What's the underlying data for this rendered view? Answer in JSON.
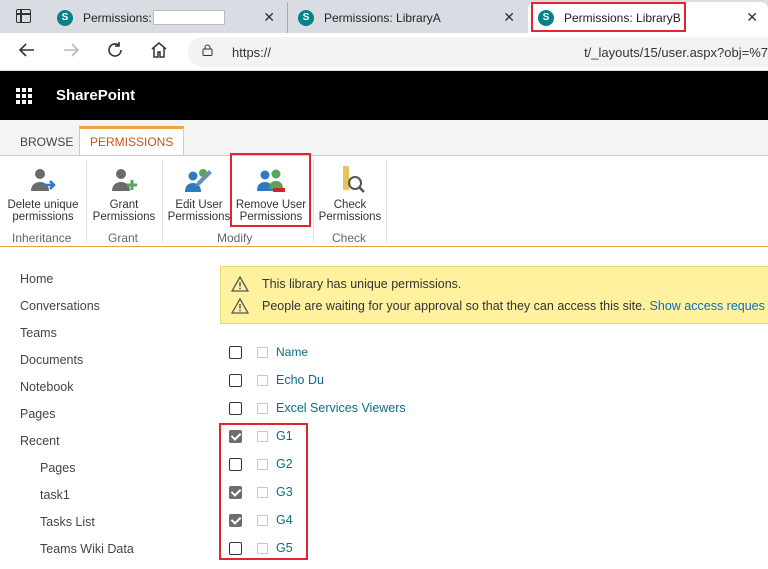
{
  "browser": {
    "tabs": [
      {
        "title": "Permissions:",
        "active": false
      },
      {
        "title": "Permissions: LibraryA",
        "active": false
      },
      {
        "title": "Permissions: LibraryB",
        "active": true
      }
    ],
    "close_glyph": "✕",
    "address": {
      "url_start": "https://",
      "url_end": "t/_layouts/15/user.aspx?obj=%7"
    }
  },
  "suite": {
    "brand": "SharePoint"
  },
  "ribbon": {
    "tabs": [
      "BROWSE",
      "PERMISSIONS"
    ],
    "active_tab": "PERMISSIONS",
    "buttons": [
      {
        "label1": "Delete unique",
        "label2": "permissions",
        "icon": "delete-unique-permissions-icon"
      },
      {
        "label1": "Grant",
        "label2": "Permissions",
        "icon": "grant-permissions-icon"
      },
      {
        "label1": "Edit User",
        "label2": "Permissions",
        "icon": "edit-user-permissions-icon"
      },
      {
        "label1": "Remove User",
        "label2": "Permissions",
        "icon": "remove-user-permissions-icon"
      },
      {
        "label1": "Check",
        "label2": "Permissions",
        "icon": "check-permissions-icon"
      }
    ],
    "groups": [
      "Inheritance",
      "Grant",
      "Modify",
      "Check"
    ]
  },
  "leftnav": {
    "items": [
      "Home",
      "Conversations",
      "Teams",
      "Documents",
      "Notebook",
      "Pages",
      "Recent"
    ],
    "sub_items": [
      "Pages",
      "task1",
      "Tasks List",
      "Teams Wiki Data"
    ]
  },
  "banner": {
    "line1": "This library has unique permissions.",
    "line2": "People are waiting for your approval so that they can access this site.",
    "link": "Show access reques"
  },
  "list": {
    "header": "Name",
    "rows": [
      {
        "name": "Echo Du",
        "checked": false
      },
      {
        "name": "Excel Services Viewers",
        "checked": false
      },
      {
        "name": "G1",
        "checked": true
      },
      {
        "name": "G2",
        "checked": false
      },
      {
        "name": "G3",
        "checked": true
      },
      {
        "name": "G4",
        "checked": true
      },
      {
        "name": "G5",
        "checked": false
      }
    ]
  },
  "colors": {
    "accent_red": "#e3262e",
    "sharepoint_teal": "#038387",
    "link": "#0b6f83",
    "ribbon_accent": "#f1a33c"
  }
}
